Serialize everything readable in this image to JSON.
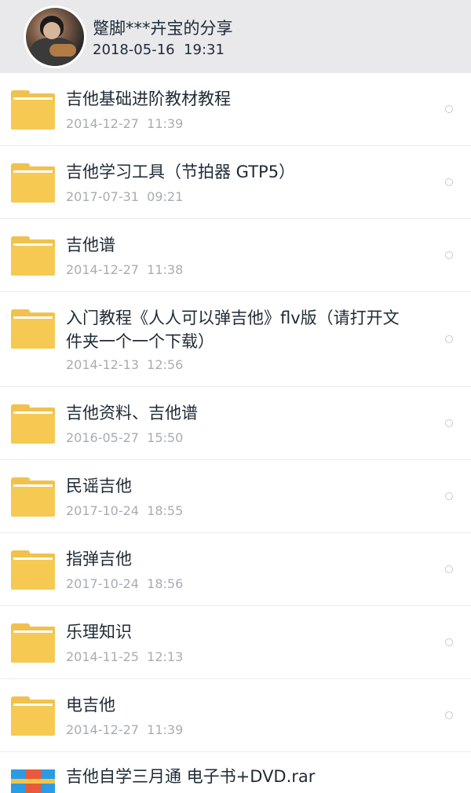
{
  "share": {
    "title": "蹩脚***卉宝的分享",
    "time": "2018-05-16  19:31"
  },
  "files": [
    {
      "name": "吉他基础进阶教材教程",
      "date": "2014-12-27  11:39",
      "icon": "folder-icon"
    },
    {
      "name": "吉他学习工具（节拍器 GTP5）",
      "date": "2017-07-31  09:21",
      "icon": "folder-icon"
    },
    {
      "name": "吉他谱",
      "date": "2014-12-27  11:38",
      "icon": "folder-icon"
    },
    {
      "name": "入门教程《人人可以弹吉他》flv版（请打开文件夹一个一个下载）",
      "date": "2014-12-13  12:56",
      "icon": "folder-icon"
    },
    {
      "name": "吉他资料、吉他谱",
      "date": "2016-05-27  15:50",
      "icon": "folder-icon"
    },
    {
      "name": "民谣吉他",
      "date": "2017-10-24  18:55",
      "icon": "folder-icon"
    },
    {
      "name": "指弹吉他",
      "date": "2017-10-24  18:56",
      "icon": "folder-icon"
    },
    {
      "name": "乐理知识",
      "date": "2014-11-25  12:13",
      "icon": "folder-icon"
    },
    {
      "name": "电吉他",
      "date": "2014-12-27  11:39",
      "icon": "folder-icon"
    },
    {
      "name": "吉他自学三月通 电子书+DVD.rar",
      "date": "",
      "icon": "rar-file-icon"
    }
  ]
}
